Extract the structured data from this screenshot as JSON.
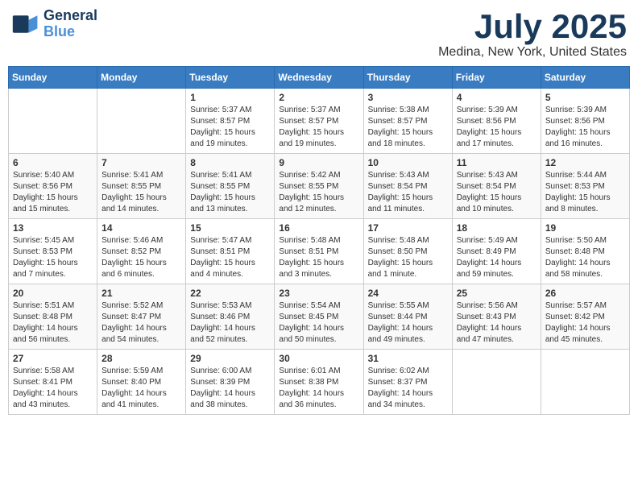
{
  "header": {
    "logo_line1": "General",
    "logo_line2": "Blue",
    "month_title": "July 2025",
    "location": "Medina, New York, United States"
  },
  "weekdays": [
    "Sunday",
    "Monday",
    "Tuesday",
    "Wednesday",
    "Thursday",
    "Friday",
    "Saturday"
  ],
  "weeks": [
    [
      {
        "day": "",
        "sunrise": "",
        "sunset": "",
        "daylight": ""
      },
      {
        "day": "",
        "sunrise": "",
        "sunset": "",
        "daylight": ""
      },
      {
        "day": "1",
        "sunrise": "Sunrise: 5:37 AM",
        "sunset": "Sunset: 8:57 PM",
        "daylight": "Daylight: 15 hours and 19 minutes."
      },
      {
        "day": "2",
        "sunrise": "Sunrise: 5:37 AM",
        "sunset": "Sunset: 8:57 PM",
        "daylight": "Daylight: 15 hours and 19 minutes."
      },
      {
        "day": "3",
        "sunrise": "Sunrise: 5:38 AM",
        "sunset": "Sunset: 8:57 PM",
        "daylight": "Daylight: 15 hours and 18 minutes."
      },
      {
        "day": "4",
        "sunrise": "Sunrise: 5:39 AM",
        "sunset": "Sunset: 8:56 PM",
        "daylight": "Daylight: 15 hours and 17 minutes."
      },
      {
        "day": "5",
        "sunrise": "Sunrise: 5:39 AM",
        "sunset": "Sunset: 8:56 PM",
        "daylight": "Daylight: 15 hours and 16 minutes."
      }
    ],
    [
      {
        "day": "6",
        "sunrise": "Sunrise: 5:40 AM",
        "sunset": "Sunset: 8:56 PM",
        "daylight": "Daylight: 15 hours and 15 minutes."
      },
      {
        "day": "7",
        "sunrise": "Sunrise: 5:41 AM",
        "sunset": "Sunset: 8:55 PM",
        "daylight": "Daylight: 15 hours and 14 minutes."
      },
      {
        "day": "8",
        "sunrise": "Sunrise: 5:41 AM",
        "sunset": "Sunset: 8:55 PM",
        "daylight": "Daylight: 15 hours and 13 minutes."
      },
      {
        "day": "9",
        "sunrise": "Sunrise: 5:42 AM",
        "sunset": "Sunset: 8:55 PM",
        "daylight": "Daylight: 15 hours and 12 minutes."
      },
      {
        "day": "10",
        "sunrise": "Sunrise: 5:43 AM",
        "sunset": "Sunset: 8:54 PM",
        "daylight": "Daylight: 15 hours and 11 minutes."
      },
      {
        "day": "11",
        "sunrise": "Sunrise: 5:43 AM",
        "sunset": "Sunset: 8:54 PM",
        "daylight": "Daylight: 15 hours and 10 minutes."
      },
      {
        "day": "12",
        "sunrise": "Sunrise: 5:44 AM",
        "sunset": "Sunset: 8:53 PM",
        "daylight": "Daylight: 15 hours and 8 minutes."
      }
    ],
    [
      {
        "day": "13",
        "sunrise": "Sunrise: 5:45 AM",
        "sunset": "Sunset: 8:53 PM",
        "daylight": "Daylight: 15 hours and 7 minutes."
      },
      {
        "day": "14",
        "sunrise": "Sunrise: 5:46 AM",
        "sunset": "Sunset: 8:52 PM",
        "daylight": "Daylight: 15 hours and 6 minutes."
      },
      {
        "day": "15",
        "sunrise": "Sunrise: 5:47 AM",
        "sunset": "Sunset: 8:51 PM",
        "daylight": "Daylight: 15 hours and 4 minutes."
      },
      {
        "day": "16",
        "sunrise": "Sunrise: 5:48 AM",
        "sunset": "Sunset: 8:51 PM",
        "daylight": "Daylight: 15 hours and 3 minutes."
      },
      {
        "day": "17",
        "sunrise": "Sunrise: 5:48 AM",
        "sunset": "Sunset: 8:50 PM",
        "daylight": "Daylight: 15 hours and 1 minute."
      },
      {
        "day": "18",
        "sunrise": "Sunrise: 5:49 AM",
        "sunset": "Sunset: 8:49 PM",
        "daylight": "Daylight: 14 hours and 59 minutes."
      },
      {
        "day": "19",
        "sunrise": "Sunrise: 5:50 AM",
        "sunset": "Sunset: 8:48 PM",
        "daylight": "Daylight: 14 hours and 58 minutes."
      }
    ],
    [
      {
        "day": "20",
        "sunrise": "Sunrise: 5:51 AM",
        "sunset": "Sunset: 8:48 PM",
        "daylight": "Daylight: 14 hours and 56 minutes."
      },
      {
        "day": "21",
        "sunrise": "Sunrise: 5:52 AM",
        "sunset": "Sunset: 8:47 PM",
        "daylight": "Daylight: 14 hours and 54 minutes."
      },
      {
        "day": "22",
        "sunrise": "Sunrise: 5:53 AM",
        "sunset": "Sunset: 8:46 PM",
        "daylight": "Daylight: 14 hours and 52 minutes."
      },
      {
        "day": "23",
        "sunrise": "Sunrise: 5:54 AM",
        "sunset": "Sunset: 8:45 PM",
        "daylight": "Daylight: 14 hours and 50 minutes."
      },
      {
        "day": "24",
        "sunrise": "Sunrise: 5:55 AM",
        "sunset": "Sunset: 8:44 PM",
        "daylight": "Daylight: 14 hours and 49 minutes."
      },
      {
        "day": "25",
        "sunrise": "Sunrise: 5:56 AM",
        "sunset": "Sunset: 8:43 PM",
        "daylight": "Daylight: 14 hours and 47 minutes."
      },
      {
        "day": "26",
        "sunrise": "Sunrise: 5:57 AM",
        "sunset": "Sunset: 8:42 PM",
        "daylight": "Daylight: 14 hours and 45 minutes."
      }
    ],
    [
      {
        "day": "27",
        "sunrise": "Sunrise: 5:58 AM",
        "sunset": "Sunset: 8:41 PM",
        "daylight": "Daylight: 14 hours and 43 minutes."
      },
      {
        "day": "28",
        "sunrise": "Sunrise: 5:59 AM",
        "sunset": "Sunset: 8:40 PM",
        "daylight": "Daylight: 14 hours and 41 minutes."
      },
      {
        "day": "29",
        "sunrise": "Sunrise: 6:00 AM",
        "sunset": "Sunset: 8:39 PM",
        "daylight": "Daylight: 14 hours and 38 minutes."
      },
      {
        "day": "30",
        "sunrise": "Sunrise: 6:01 AM",
        "sunset": "Sunset: 8:38 PM",
        "daylight": "Daylight: 14 hours and 36 minutes."
      },
      {
        "day": "31",
        "sunrise": "Sunrise: 6:02 AM",
        "sunset": "Sunset: 8:37 PM",
        "daylight": "Daylight: 14 hours and 34 minutes."
      },
      {
        "day": "",
        "sunrise": "",
        "sunset": "",
        "daylight": ""
      },
      {
        "day": "",
        "sunrise": "",
        "sunset": "",
        "daylight": ""
      }
    ]
  ]
}
